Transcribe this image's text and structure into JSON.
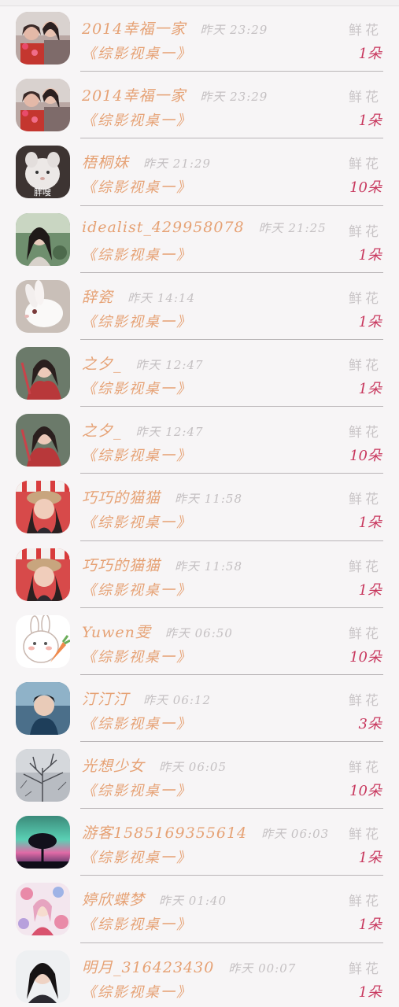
{
  "gifts": [
    {
      "name": "2014幸福一家",
      "time": "昨天 23:29",
      "book": "《综影视桌一》",
      "type": "鲜花",
      "amount": "1朵",
      "avatar": "couple-photo"
    },
    {
      "name": "2014幸福一家",
      "time": "昨天 23:29",
      "book": "《综影视桌一》",
      "type": "鲜花",
      "amount": "1朵",
      "avatar": "couple-photo"
    },
    {
      "name": "梧桐妹",
      "time": "昨天 21:29",
      "book": "《综影视桌一》",
      "type": "鲜花",
      "amount": "10朵",
      "avatar": "white-pet-photo",
      "avatar_caption": "胖嗖"
    },
    {
      "name": "idealist_429958078",
      "time": "昨天 21:25",
      "book": "《综影视桌一》",
      "type": "鲜花",
      "amount": "1朵",
      "avatar": "girl-in-forest-photo"
    },
    {
      "name": "辞瓷",
      "time": "昨天 14:14",
      "book": "《综影视桌一》",
      "type": "鲜花",
      "amount": "1朵",
      "avatar": "white-rabbit-photo"
    },
    {
      "name": "之夕_",
      "time": "昨天 12:47",
      "book": "《综影视桌一》",
      "type": "鲜花",
      "amount": "1朵",
      "avatar": "costume-girl-photo"
    },
    {
      "name": "之夕_",
      "time": "昨天 12:47",
      "book": "《综影视桌一》",
      "type": "鲜花",
      "amount": "10朵",
      "avatar": "costume-girl-photo"
    },
    {
      "name": "巧巧的猫猫",
      "time": "昨天 11:58",
      "book": "《综影视桌一》",
      "type": "鲜花",
      "amount": "1朵",
      "avatar": "girl-with-hat-photo"
    },
    {
      "name": "巧巧的猫猫",
      "time": "昨天 11:58",
      "book": "《综影视桌一》",
      "type": "鲜花",
      "amount": "1朵",
      "avatar": "girl-with-hat-photo"
    },
    {
      "name": "Yuwen雯",
      "time": "昨天 06:50",
      "book": "《综影视桌一》",
      "type": "鲜花",
      "amount": "10朵",
      "avatar": "cartoon-bunny-carrot"
    },
    {
      "name": "汀汀汀",
      "time": "昨天 06:12",
      "book": "《综影视桌一》",
      "type": "鲜花",
      "amount": "3朵",
      "avatar": "boy-portrait-photo"
    },
    {
      "name": "光想少女",
      "time": "昨天 06:05",
      "book": "《综影视桌一》",
      "type": "鲜花",
      "amount": "10朵",
      "avatar": "winter-tree-photo"
    },
    {
      "name": "游客1585169355614",
      "time": "昨天 06:03",
      "book": "《综影视桌一》",
      "type": "鲜花",
      "amount": "1朵",
      "avatar": "tree-night-sky-photo"
    },
    {
      "name": "婷欣蝶梦",
      "time": "昨天 01:40",
      "book": "《综影视桌一》",
      "type": "鲜花",
      "amount": "1朵",
      "avatar": "anime-flowers-art"
    },
    {
      "name": "明月_316423430",
      "time": "昨天 00:07",
      "book": "《综影视桌一》",
      "type": "鲜花",
      "amount": "1朵",
      "avatar": "girl-portrait-photo"
    }
  ]
}
